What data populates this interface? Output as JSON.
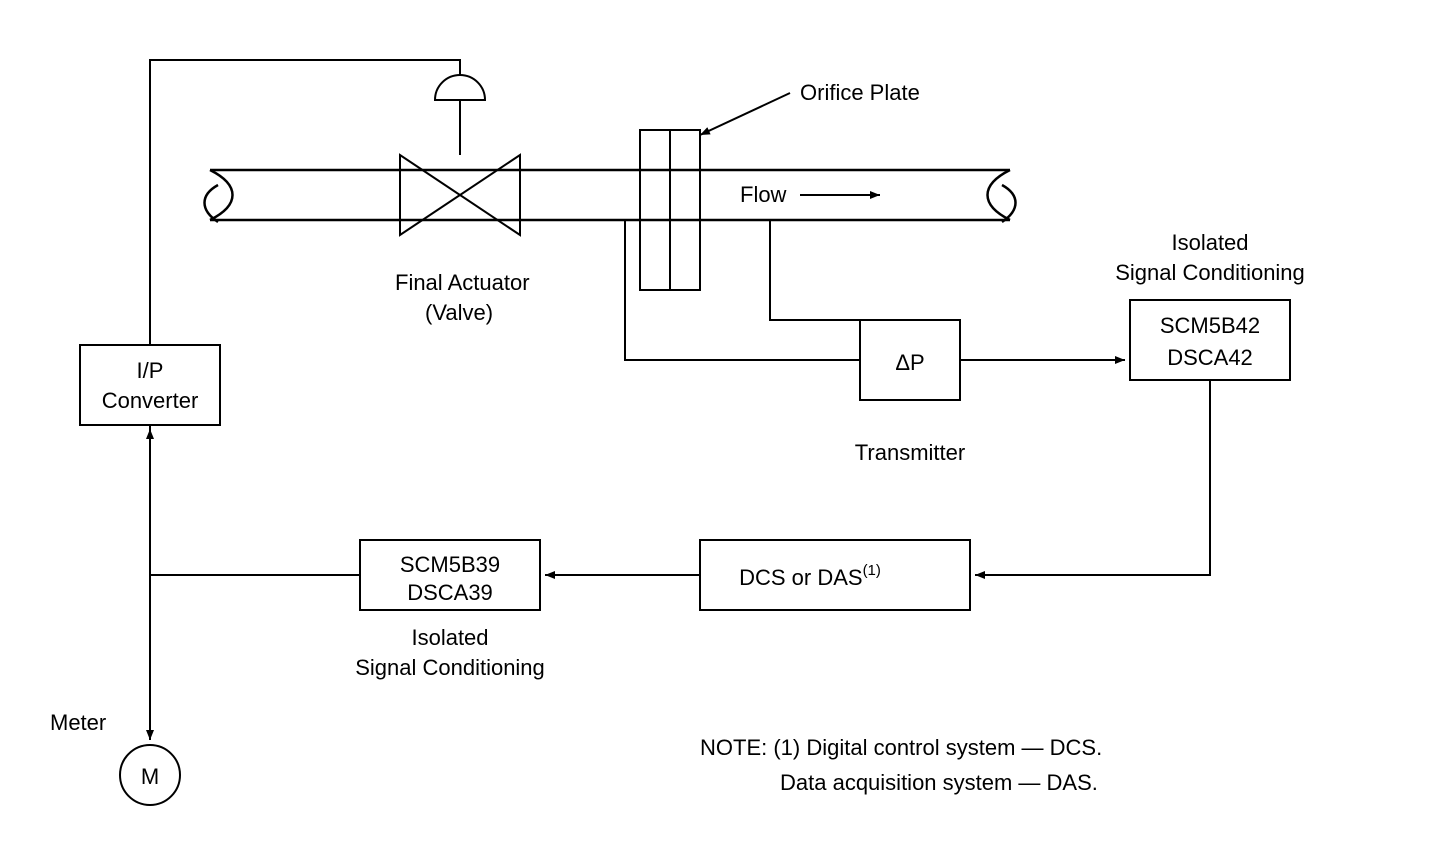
{
  "labels": {
    "ip_converter_1": "I/P",
    "ip_converter_2": "Converter",
    "final_actuator_1": "Final Actuator",
    "final_actuator_2": "(Valve)",
    "orifice_plate": "Orifice Plate",
    "flow": "Flow",
    "delta_p": "ΔP",
    "transmitter": "Transmitter",
    "isolated_cond_1a": "Isolated",
    "isolated_cond_1b": "Signal Conditioning",
    "scm5b42": "SCM5B42",
    "dsca42": "DSCA42",
    "dcs_das": "DCS or DAS",
    "dcs_das_sup": "(1)",
    "scm5b39": "SCM5B39",
    "dsca39": "DSCA39",
    "isolated_cond_2a": "Isolated",
    "isolated_cond_2b": "Signal Conditioning",
    "meter": "Meter",
    "meter_m": "M",
    "note_1": "NOTE: (1) Digital control system — DCS.",
    "note_2": "Data acquisition system — DAS."
  }
}
